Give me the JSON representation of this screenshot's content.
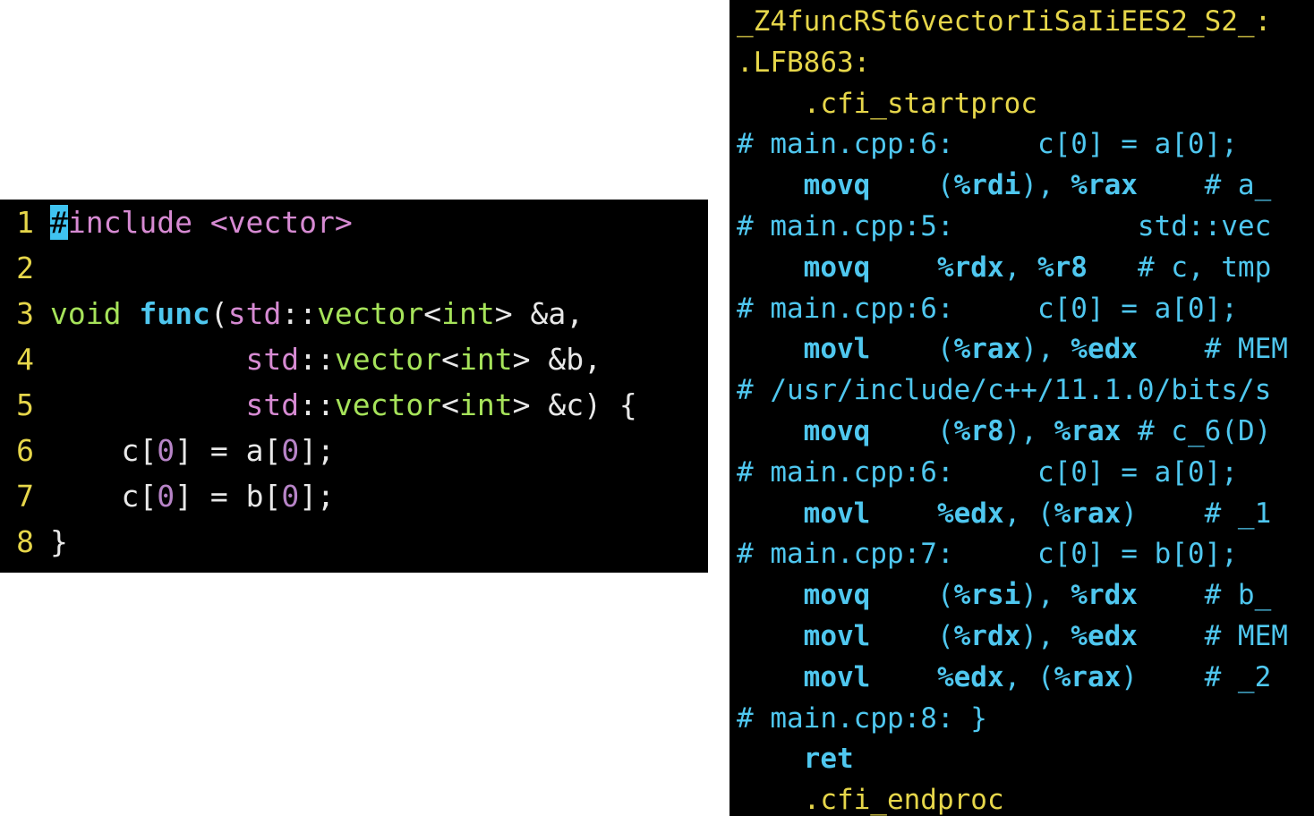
{
  "source": {
    "lines": [
      {
        "n": "1",
        "parts": [
          [
            "cursor",
            "#"
          ],
          [
            "pp",
            "include <vector>"
          ]
        ]
      },
      {
        "n": "2",
        "parts": []
      },
      {
        "n": "3",
        "parts": [
          [
            "kw",
            "void "
          ],
          [
            "fn",
            "func"
          ],
          [
            "plain",
            "("
          ],
          [
            "ns",
            "std"
          ],
          [
            "plain",
            "::"
          ],
          [
            "kw",
            "vector"
          ],
          [
            "plain",
            "<"
          ],
          [
            "kw",
            "int"
          ],
          [
            "plain",
            "> &a,"
          ]
        ]
      },
      {
        "n": "4",
        "parts": [
          [
            "plain",
            "           "
          ],
          [
            "ns",
            "std"
          ],
          [
            "plain",
            "::"
          ],
          [
            "kw",
            "vector"
          ],
          [
            "plain",
            "<"
          ],
          [
            "kw",
            "int"
          ],
          [
            "plain",
            "> &b,"
          ]
        ]
      },
      {
        "n": "5",
        "parts": [
          [
            "plain",
            "           "
          ],
          [
            "ns",
            "std"
          ],
          [
            "plain",
            "::"
          ],
          [
            "kw",
            "vector"
          ],
          [
            "plain",
            "<"
          ],
          [
            "kw",
            "int"
          ],
          [
            "plain",
            "> &c) {"
          ]
        ]
      },
      {
        "n": "6",
        "parts": [
          [
            "plain",
            "    c["
          ],
          [
            "num",
            "0"
          ],
          [
            "plain",
            "] = a["
          ],
          [
            "num",
            "0"
          ],
          [
            "plain",
            "];"
          ]
        ]
      },
      {
        "n": "7",
        "parts": [
          [
            "plain",
            "    c["
          ],
          [
            "num",
            "0"
          ],
          [
            "plain",
            "] = b["
          ],
          [
            "num",
            "0"
          ],
          [
            "plain",
            "];"
          ]
        ]
      },
      {
        "n": "8",
        "parts": [
          [
            "plain",
            "}"
          ]
        ]
      }
    ]
  },
  "assembly": {
    "lines": [
      [
        [
          "lbl",
          "_Z4funcRSt6vectorIiSaIiEES2_S2_:"
        ]
      ],
      [
        [
          "lbl",
          ".LFB863:"
        ]
      ],
      [
        [
          "dir",
          "    .cfi_startproc"
        ]
      ],
      [
        [
          "cmt",
          "# main.cpp:6:     c[0] = a[0];"
        ]
      ],
      [
        [
          "asmtxt",
          "    "
        ],
        [
          "instr",
          "movq"
        ],
        [
          "asmtxt",
          "    ("
        ],
        [
          "reg",
          "%rdi"
        ],
        [
          "asmtxt",
          "), "
        ],
        [
          "reg",
          "%rax"
        ],
        [
          "asmtxt",
          "    # a_"
        ]
      ],
      [
        [
          "cmt",
          "# main.cpp:5:           std::vec"
        ]
      ],
      [
        [
          "asmtxt",
          "    "
        ],
        [
          "instr",
          "movq"
        ],
        [
          "asmtxt",
          "    "
        ],
        [
          "reg",
          "%rdx"
        ],
        [
          "asmtxt",
          ", "
        ],
        [
          "reg",
          "%r8"
        ],
        [
          "asmtxt",
          "   # c, tmp"
        ]
      ],
      [
        [
          "cmt",
          "# main.cpp:6:     c[0] = a[0];"
        ]
      ],
      [
        [
          "asmtxt",
          "    "
        ],
        [
          "instr",
          "movl"
        ],
        [
          "asmtxt",
          "    ("
        ],
        [
          "reg",
          "%rax"
        ],
        [
          "asmtxt",
          "), "
        ],
        [
          "reg",
          "%edx"
        ],
        [
          "asmtxt",
          "    # MEM"
        ]
      ],
      [
        [
          "cmt",
          "# /usr/include/c++/11.1.0/bits/s"
        ]
      ],
      [
        [
          "asmtxt",
          "    "
        ],
        [
          "instr",
          "movq"
        ],
        [
          "asmtxt",
          "    ("
        ],
        [
          "reg",
          "%r8"
        ],
        [
          "asmtxt",
          "), "
        ],
        [
          "reg",
          "%rax"
        ],
        [
          "asmtxt",
          " # c_6(D)"
        ]
      ],
      [
        [
          "cmt",
          "# main.cpp:6:     c[0] = a[0];"
        ]
      ],
      [
        [
          "asmtxt",
          "    "
        ],
        [
          "instr",
          "movl"
        ],
        [
          "asmtxt",
          "    "
        ],
        [
          "reg",
          "%edx"
        ],
        [
          "asmtxt",
          ", ("
        ],
        [
          "reg",
          "%rax"
        ],
        [
          "asmtxt",
          ")    # _1"
        ]
      ],
      [
        [
          "cmt",
          "# main.cpp:7:     c[0] = b[0];"
        ]
      ],
      [
        [
          "asmtxt",
          "    "
        ],
        [
          "instr",
          "movq"
        ],
        [
          "asmtxt",
          "    ("
        ],
        [
          "reg",
          "%rsi"
        ],
        [
          "asmtxt",
          "), "
        ],
        [
          "reg",
          "%rdx"
        ],
        [
          "asmtxt",
          "    # b_"
        ]
      ],
      [
        [
          "asmtxt",
          "    "
        ],
        [
          "instr",
          "movl"
        ],
        [
          "asmtxt",
          "    ("
        ],
        [
          "reg",
          "%rdx"
        ],
        [
          "asmtxt",
          "), "
        ],
        [
          "reg",
          "%edx"
        ],
        [
          "asmtxt",
          "    # MEM"
        ]
      ],
      [
        [
          "asmtxt",
          "    "
        ],
        [
          "instr",
          "movl"
        ],
        [
          "asmtxt",
          "    "
        ],
        [
          "reg",
          "%edx"
        ],
        [
          "asmtxt",
          ", ("
        ],
        [
          "reg",
          "%rax"
        ],
        [
          "asmtxt",
          ")    # _2"
        ]
      ],
      [
        [
          "cmt",
          "# main.cpp:8: }"
        ]
      ],
      [
        [
          "asmtxt",
          "    "
        ],
        [
          "instr",
          "ret"
        ]
      ],
      [
        [
          "dir",
          "    .cfi_endproc"
        ]
      ]
    ]
  }
}
